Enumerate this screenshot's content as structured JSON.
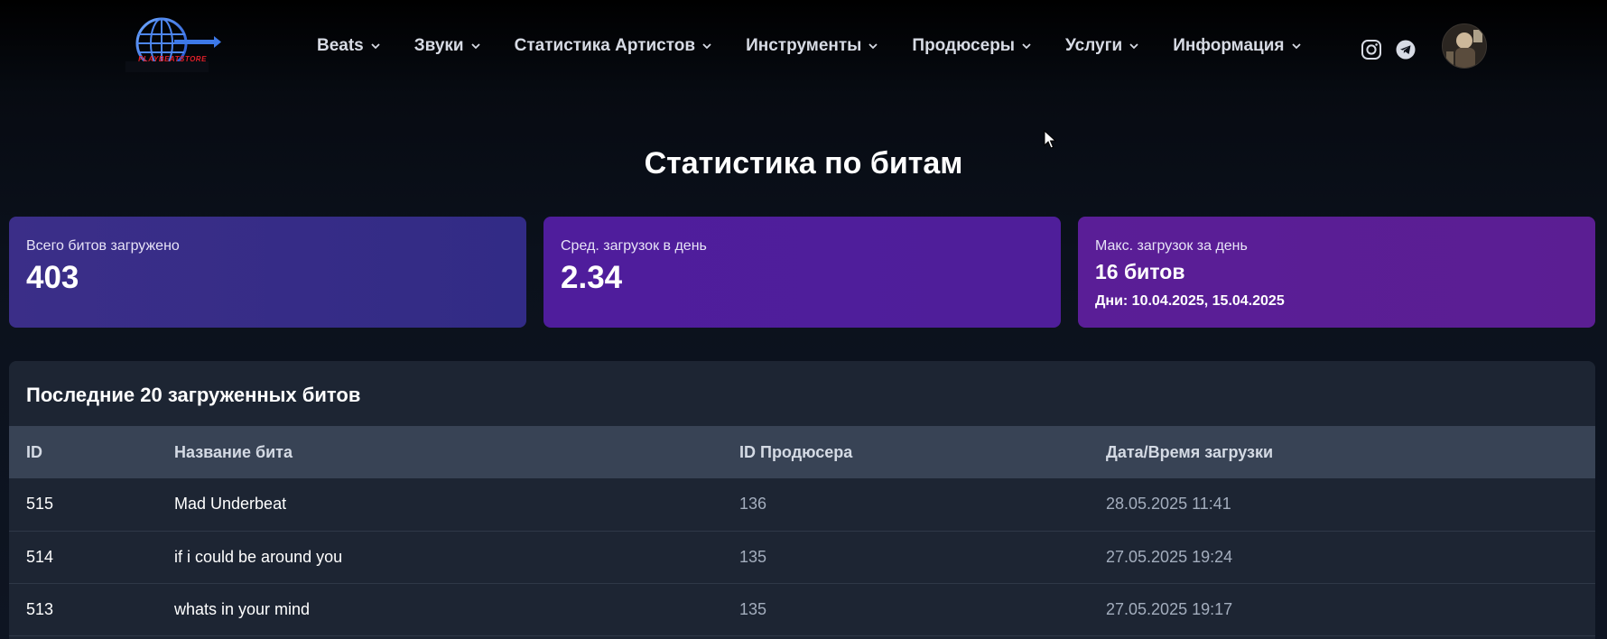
{
  "header": {
    "logo_text": "PLAYBEATSTORE",
    "nav": [
      {
        "label": "Beats"
      },
      {
        "label": "Звуки"
      },
      {
        "label": "Статистика Артистов"
      },
      {
        "label": "Инструменты"
      },
      {
        "label": "Продюсеры"
      },
      {
        "label": "Услуги"
      },
      {
        "label": "Информация"
      }
    ],
    "icons": {
      "instagram": "instagram-icon",
      "telegram": "telegram-icon",
      "chevron": "chevron-down-icon"
    }
  },
  "page": {
    "title": "Статистика по битам"
  },
  "stats": {
    "total": {
      "label": "Всего битов загружено",
      "value": "403"
    },
    "avg": {
      "label": "Сред. загрузок в день",
      "value": "2.34"
    },
    "max": {
      "label": "Макс. загрузок за день",
      "value": "16 битов",
      "days": "Дни: 10.04.2025, 15.04.2025"
    }
  },
  "recent": {
    "title": "Последние 20 загруженных битов",
    "columns": [
      "ID",
      "Название бита",
      "ID Продюсера",
      "Дата/Время загрузки"
    ],
    "rows": [
      {
        "id": "515",
        "name": "Mad Underbeat",
        "producer": "136",
        "date": "28.05.2025 11:41"
      },
      {
        "id": "514",
        "name": "if i could be around you",
        "producer": "135",
        "date": "27.05.2025 19:24"
      },
      {
        "id": "513",
        "name": "whats in your mind",
        "producer": "135",
        "date": "27.05.2025 19:17"
      }
    ]
  },
  "colors": {
    "card_total": "#3b2e88",
    "card_avg": "#4f1d9c",
    "card_max": "#5a1e97",
    "table_header": "#384355",
    "panel": "#1d2533"
  }
}
